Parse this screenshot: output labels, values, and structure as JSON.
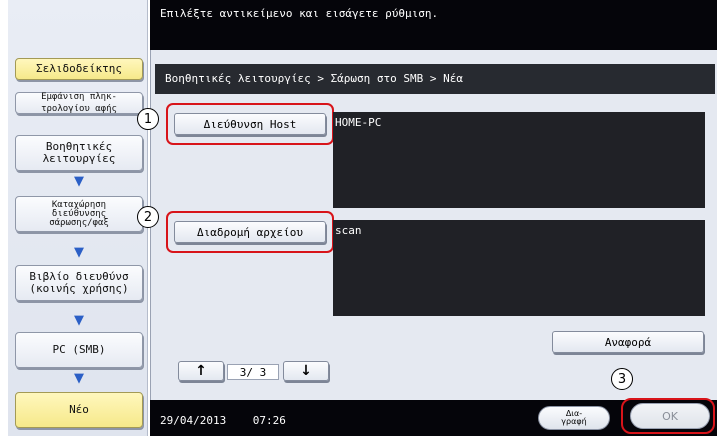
{
  "topbar": {
    "instruction": "Επιλέξτε αντικείμενο και εισάγετε ρύθμιση."
  },
  "sidebar": {
    "bookmark": "Σελιδοδείκτης",
    "keyboard": "Εμφάνιση πληκ-\nτρολογίου αφής",
    "steps": [
      "Βοηθητικές\nλειτουργίες",
      "Καταχώρηση\nδιεύθυνσης\nσάρωσης/φαξ",
      "Βιβλίο διευθύνσ\n(κοινής χρήσης)",
      "PC (SMB)"
    ],
    "new": "Νέο"
  },
  "breadcrumb": "Βοηθητικές λειτουργίες > Σάρωση στο SMB > Νέα",
  "fields": {
    "host_label": "Διεύθυνση Host",
    "host_value": "HOME-PC",
    "path_label": "Διαδρομή αρχείου",
    "path_value": "scan"
  },
  "pager": {
    "page": "3/ 3"
  },
  "reference_label": "Αναφορά",
  "bottom": {
    "datetime": "29/04/2013    07:26",
    "delete_label": "Δια-\nγραφή",
    "ok_label": "OK"
  },
  "callouts": [
    "1",
    "2",
    "3"
  ]
}
